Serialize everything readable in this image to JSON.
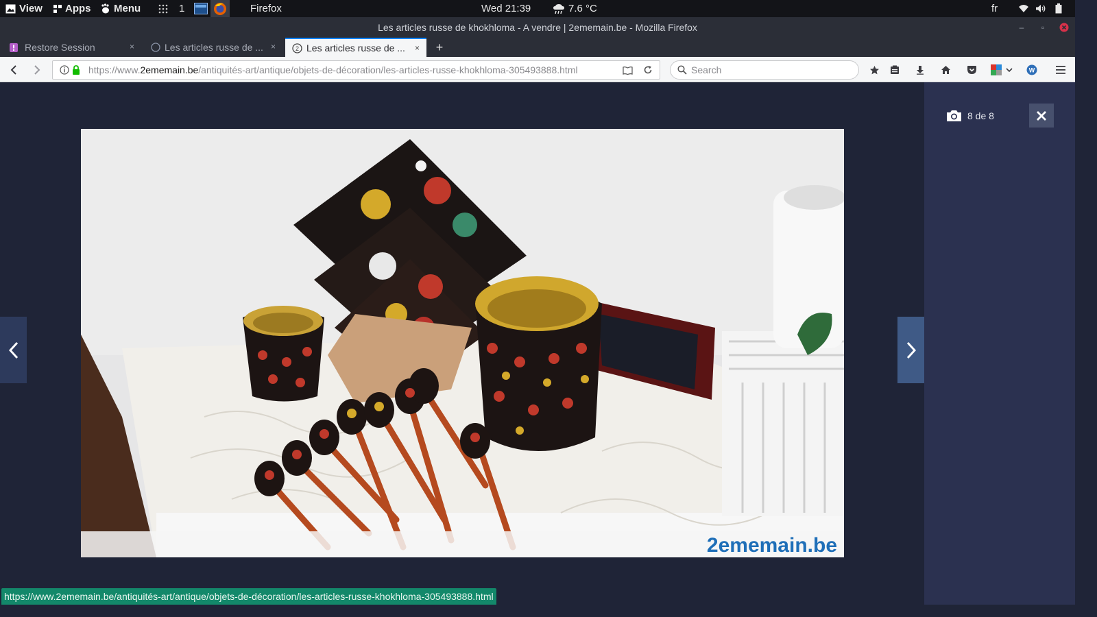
{
  "panel": {
    "view_label": "View",
    "apps_label": "Apps",
    "menu_label": "Menu",
    "workspace_number": "1",
    "active_app": "Firefox",
    "clock": "Wed 21:39",
    "weather": "7.6 °C",
    "keyboard_layout": "fr"
  },
  "window": {
    "title": "Les articles russe de khokhloma - A vendre | 2ememain.be - Mozilla Firefox"
  },
  "tabs": [
    {
      "label": "Restore Session",
      "close": "×"
    },
    {
      "label": "Les articles russe de ...",
      "close": "×"
    },
    {
      "label": "Les articles russe de ...",
      "close": "×"
    }
  ],
  "newtab_label": "+",
  "urlbar": {
    "scheme": "https://www.",
    "host": "2ememain.be",
    "path": "/antiquités-art/antique/objets-de-décoration/les-articles-russe-khokhloma-305493888.html"
  },
  "search": {
    "placeholder": "Search"
  },
  "viewer": {
    "counter": "8 de 8",
    "watermark": "2ememain.be"
  },
  "status_url": "https://www.2ememain.be/antiquités-art/antique/objets-de-décoration/les-articles-russe-khokhloma-305493888.html",
  "colors": {
    "page_bg": "#1f2437",
    "sidebar_bg": "#2b3150",
    "accent_tab": "#0a84ff",
    "status_bg": "#13886a"
  }
}
